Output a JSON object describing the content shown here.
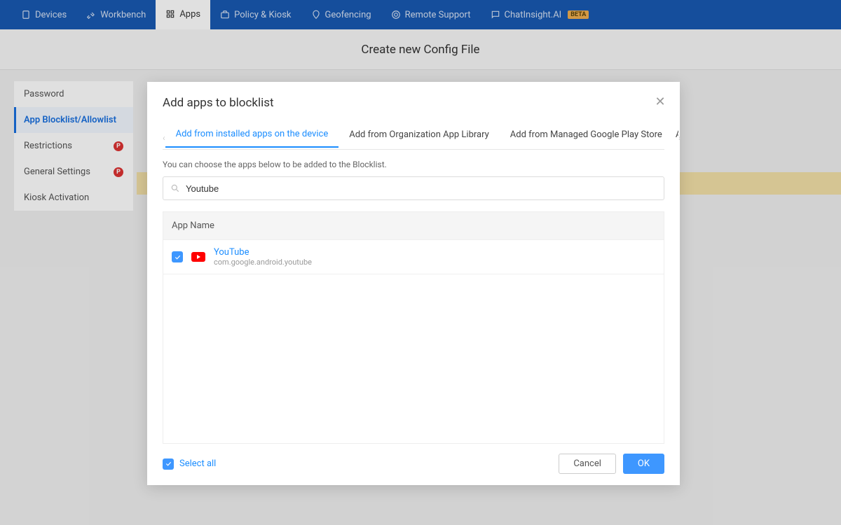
{
  "topnav": {
    "items": [
      {
        "label": "Devices",
        "icon": "device"
      },
      {
        "label": "Workbench",
        "icon": "wrench"
      },
      {
        "label": "Apps",
        "icon": "grid",
        "active": true
      },
      {
        "label": "Policy & Kiosk",
        "icon": "briefcase"
      },
      {
        "label": "Geofencing",
        "icon": "pin"
      },
      {
        "label": "Remote Support",
        "icon": "lifesaver"
      },
      {
        "label": "ChatInsight.AI",
        "icon": "chat",
        "beta": "BETA"
      }
    ]
  },
  "page": {
    "title": "Create new Config File"
  },
  "sidebar": {
    "items": [
      {
        "label": "Password"
      },
      {
        "label": "App Blocklist/Allowlist",
        "active": true
      },
      {
        "label": "Restrictions",
        "badge": "P"
      },
      {
        "label": "General Settings",
        "badge": "P"
      },
      {
        "label": "Kiosk Activation"
      }
    ]
  },
  "modal": {
    "title": "Add apps to blocklist",
    "tabs": [
      {
        "label": "Add from installed apps on the device",
        "active": true
      },
      {
        "label": "Add from Organization App Library"
      },
      {
        "label": "Add from Managed Google Play Store"
      },
      {
        "label": "A"
      }
    ],
    "hint": "You can choose the apps below to be added to the Blocklist.",
    "search": {
      "value": "Youtube",
      "placeholder": ""
    },
    "table": {
      "header": "App Name",
      "rows": [
        {
          "name": "YouTube",
          "package": "com.google.android.youtube",
          "checked": true
        }
      ]
    },
    "footer": {
      "select_all_label": "Select all",
      "select_all_checked": true,
      "cancel": "Cancel",
      "ok": "OK"
    }
  }
}
